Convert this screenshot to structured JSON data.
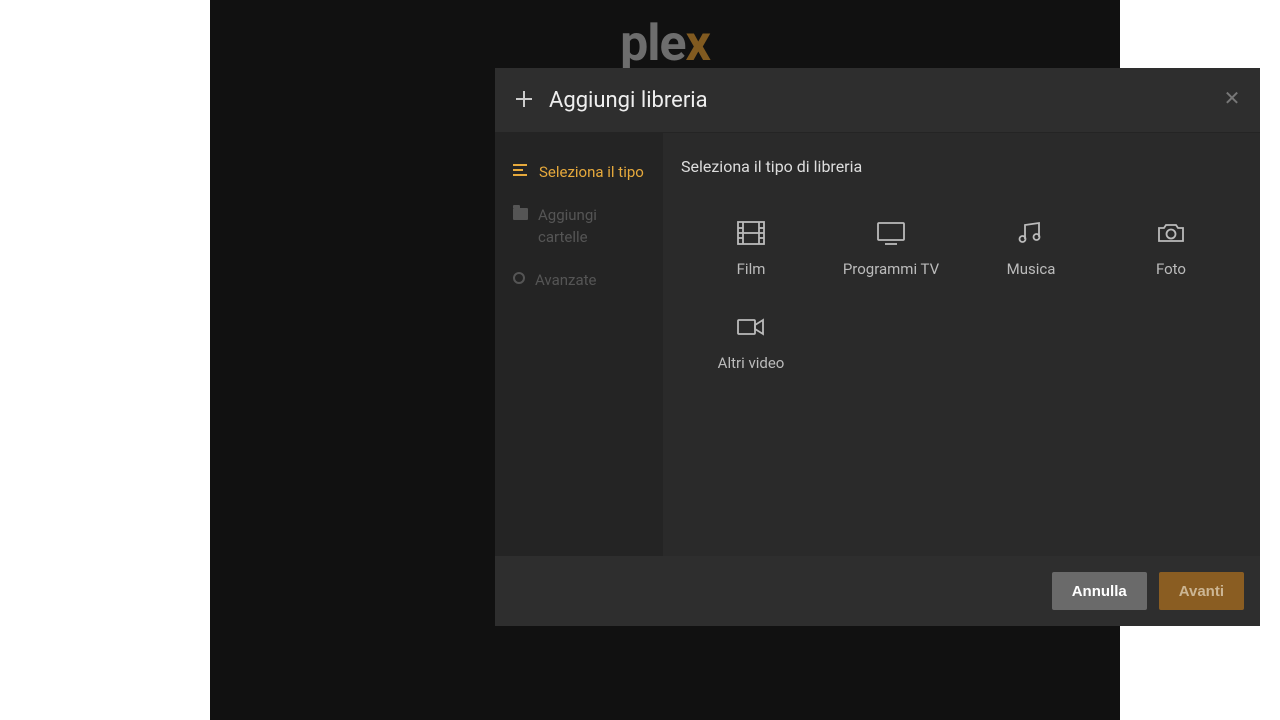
{
  "brand": {
    "name_part1": "ple",
    "name_part2": "x"
  },
  "modal": {
    "title": "Aggiungi libreria",
    "content_title": "Seleziona il tipo di libreria",
    "steps": [
      {
        "label": "Seleziona il tipo",
        "active": true
      },
      {
        "label": "Aggiungi cartelle",
        "active": false
      },
      {
        "label": "Avanzate",
        "active": false
      }
    ],
    "types": [
      {
        "label": "Film",
        "icon": "film"
      },
      {
        "label": "Programmi TV",
        "icon": "tv"
      },
      {
        "label": "Musica",
        "icon": "music"
      },
      {
        "label": "Foto",
        "icon": "camera"
      },
      {
        "label": "Altri video",
        "icon": "video"
      }
    ],
    "buttons": {
      "cancel": "Annulla",
      "next": "Avanti"
    }
  }
}
